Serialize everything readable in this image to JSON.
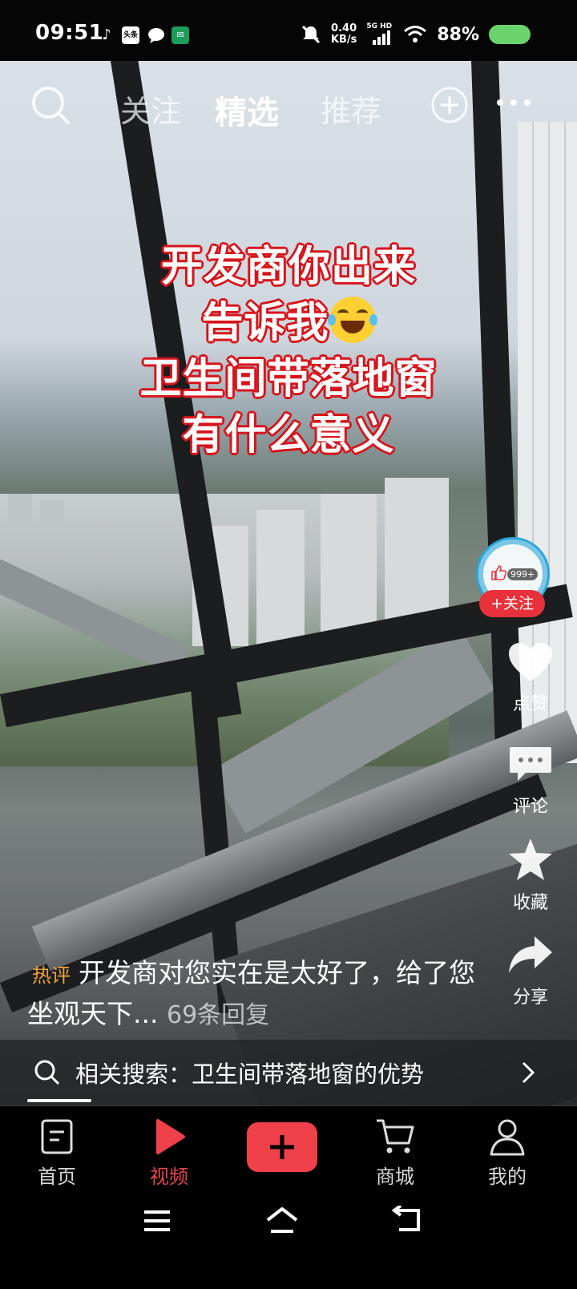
{
  "status_bar": {
    "time": "09:51",
    "app_icons": [
      "tiktok-icon",
      "toutiao-icon",
      "message-icon",
      "post-icon"
    ],
    "toutiao_label": "头条",
    "net_speed_value": "0.40",
    "net_speed_unit": "KB/s",
    "network": "5G HD",
    "battery_pct": "88%"
  },
  "top_tabs": {
    "items": [
      "关注",
      "精选",
      "推荐"
    ],
    "active": "精选"
  },
  "caption": {
    "line1": "开发商你出来",
    "line2": "告诉我",
    "line3": "卫生间带落地窗",
    "line4": "有什么意义"
  },
  "side_actions": {
    "follow_label": "+关注",
    "avatar_badge": "999+",
    "like_label": "点赞",
    "comment_label": "评论",
    "favorite_label": "收藏",
    "share_label": "分享"
  },
  "hot_comment": {
    "tag": "热评",
    "text": "开发商对您实在是太好了，给了您坐观天下...",
    "replies": "69条回复"
  },
  "related_search": {
    "label": "相关搜索：卫生间带落地窗的优势"
  },
  "bottom_nav": {
    "items": [
      "首页",
      "视频",
      "商城",
      "我的"
    ],
    "active": "视频"
  },
  "colors": {
    "accent": "#f0404a",
    "caption_outline": "#d7141b",
    "hot_tag": "#f1a33a",
    "battery": "#6bd36b"
  }
}
